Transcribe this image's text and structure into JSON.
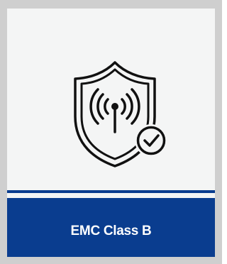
{
  "card": {
    "icon": "shield-signal-check-icon",
    "label": "EMC Class B"
  },
  "colors": {
    "accent": "#0a3d8f",
    "frame": "#cfcfcf",
    "panel": "#f4f5f5",
    "icon_stroke": "#111111"
  }
}
